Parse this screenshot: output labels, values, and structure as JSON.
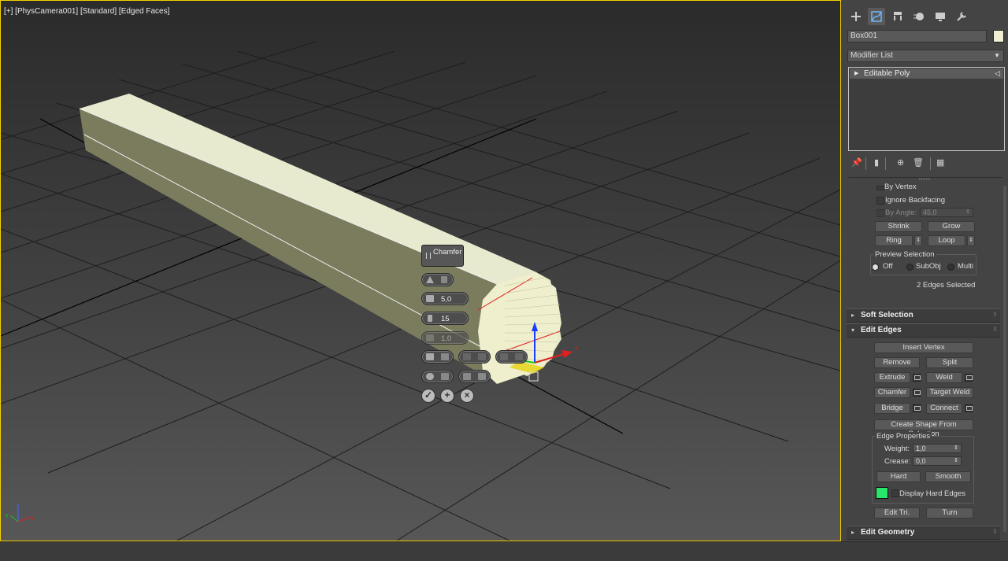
{
  "viewport": {
    "label": "[+] [PhysCamera001] [Standard] [Edged Faces]",
    "caddy": {
      "title": "Chamfer",
      "amount": "5,0",
      "segments": "15",
      "tension": "1,0"
    }
  },
  "panel": {
    "tabs": [
      "create-icon",
      "modify-icon",
      "hierarchy-icon",
      "motion-icon",
      "display-icon",
      "utilities-icon"
    ],
    "object_name": "Box001",
    "object_color": "#f0efd2",
    "modifier_list": "Modifier List",
    "stack": [
      "Editable Poly"
    ],
    "selection": {
      "by_vertex": "By Vertex",
      "ignore_backfacing": "Ignore Backfacing",
      "by_angle": "By Angle:",
      "by_angle_value": "45,0",
      "shrink": "Shrink",
      "grow": "Grow",
      "ring": "Ring",
      "loop": "Loop",
      "preview_title": "Preview Selection",
      "preview_off": "Off",
      "preview_subobj": "SubObj",
      "preview_multi": "Multi",
      "status": "2 Edges Selected"
    },
    "soft_selection": "Soft Selection",
    "edit_edges": {
      "title": "Edit Edges",
      "insert_vertex": "Insert Vertex",
      "remove": "Remove",
      "split": "Split",
      "extrude": "Extrude",
      "weld": "Weld",
      "chamfer": "Chamfer",
      "target_weld": "Target Weld",
      "bridge": "Bridge",
      "connect": "Connect",
      "create_shape": "Create Shape From Selection",
      "edge_props_title": "Edge Properties",
      "weight_label": "Weight:",
      "weight": "1,0",
      "crease_label": "Crease:",
      "crease": "0,0",
      "hard": "Hard",
      "smooth": "Smooth",
      "display_hard_edges": "Display Hard Edges",
      "hard_edge_color": "#27e66a",
      "edit_tri": "Edit Tri.",
      "turn": "Turn"
    },
    "edit_geometry": "Edit Geometry"
  }
}
